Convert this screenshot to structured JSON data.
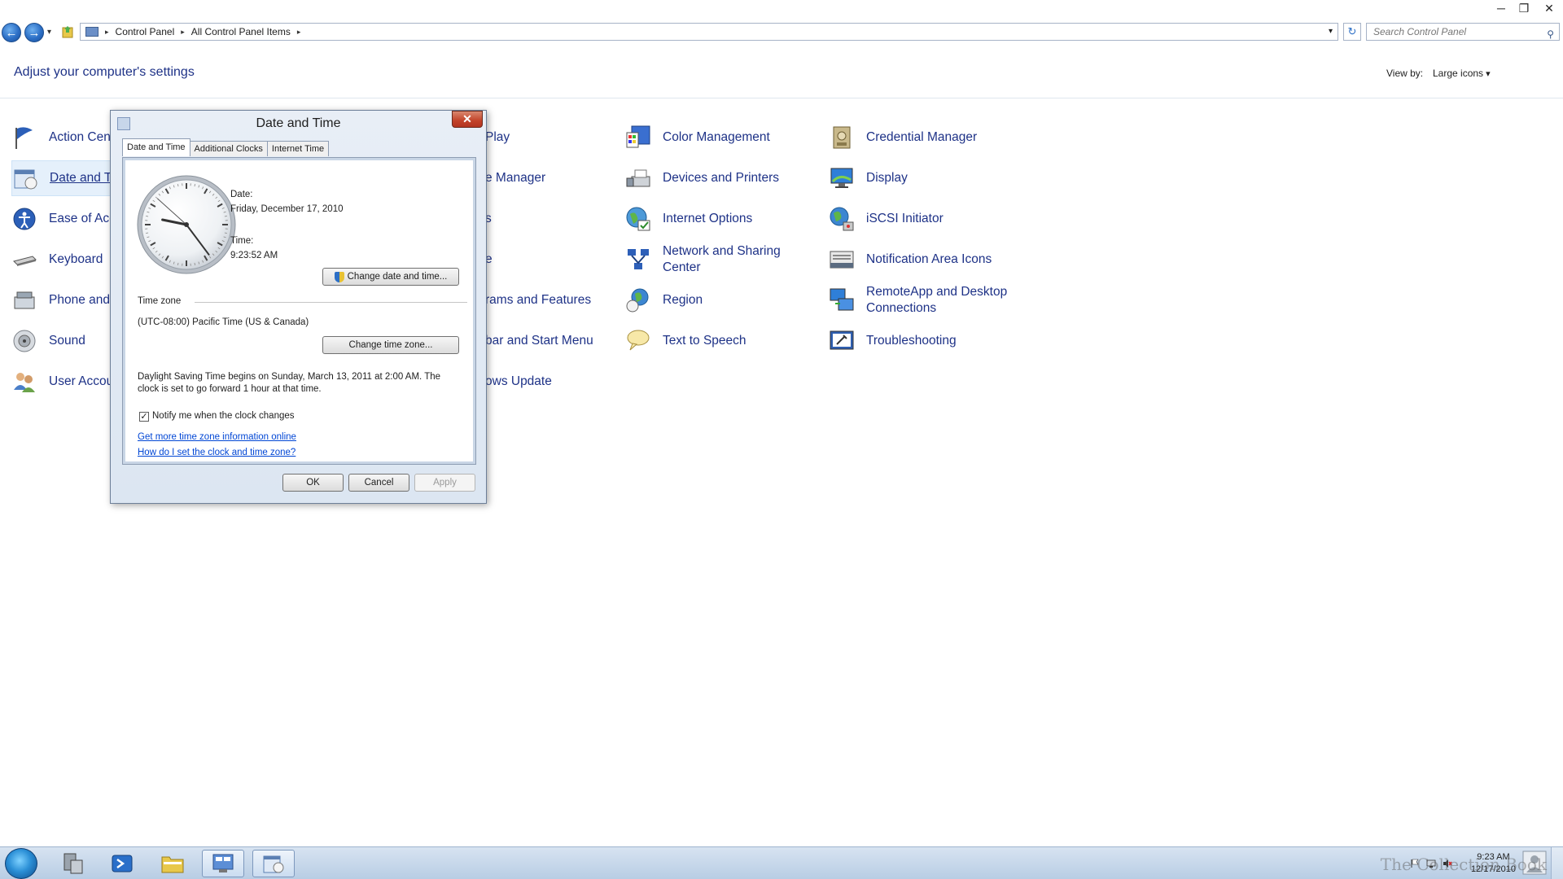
{
  "explorer": {
    "breadcrumbs": [
      "Control Panel",
      "All Control Panel Items"
    ],
    "search_placeholder": "Search Control Panel",
    "page_title": "Adjust your computer's settings",
    "view_by_label": "View by:",
    "view_by_value": "Large icons"
  },
  "items": {
    "col1": [
      "Action Center",
      "Date and Time",
      "Ease of Access Center",
      "Keyboard",
      "Phone and Modem",
      "Sound",
      "User Accounts"
    ],
    "col2": [
      "AutoPlay",
      "Device Manager",
      "Fonts",
      "Mouse",
      "Programs and Features",
      "Taskbar and Start Menu",
      "Windows Update"
    ],
    "col3": [
      "Color Management",
      "Devices and Printers",
      "Internet Options",
      "Network and Sharing Center",
      "Region",
      "Text to Speech"
    ],
    "col4": [
      "Credential Manager",
      "Display",
      "iSCSI Initiator",
      "Notification Area Icons",
      "RemoteApp and Desktop Connections",
      "Troubleshooting"
    ]
  },
  "col2_visible": [
    "Play",
    "e Manager",
    "s",
    "e",
    "rams and Features",
    "bar and Start Menu",
    "ows Update"
  ],
  "col1_visible": [
    "Action Cen",
    "Date and T",
    "Ease of Acc",
    "Keyboard",
    "Phone and",
    "Sound",
    "User Accou"
  ],
  "dialog": {
    "title": "Date and Time",
    "tabs": [
      "Date and Time",
      "Additional Clocks",
      "Internet Time"
    ],
    "date_label": "Date:",
    "date_value": "Friday, December 17, 2010",
    "time_label": "Time:",
    "time_value": "9:23:52 AM",
    "change_datetime_button": "Change date and time...",
    "timezone_label": "Time zone",
    "timezone_value": "(UTC-08:00) Pacific Time (US & Canada)",
    "change_timezone_button": "Change time zone...",
    "dst_line1": "Daylight Saving Time begins on Sunday, March 13, 2011 at 2:00 AM. The",
    "dst_line2": "clock is set to go forward 1 hour at that time.",
    "notify_checkbox_label": "Notify me when the clock changes",
    "notify_checked": true,
    "link_more_info": "Get more time zone information online",
    "link_how_to": "How do I set the clock and time zone?",
    "ok_button": "OK",
    "cancel_button": "Cancel",
    "apply_button": "Apply",
    "clock": {
      "hours": 9,
      "minutes": 23,
      "seconds": 52
    }
  },
  "taskbar": {
    "clock_time": "9:23 AM",
    "clock_date": "12/17/2010",
    "watermark": "The Collection Book"
  },
  "colors": {
    "link_blue": "#1e3287",
    "hyperlink": "#0046d5",
    "close_red": "#c24229",
    "selection_bg": "#e5f0fb"
  }
}
